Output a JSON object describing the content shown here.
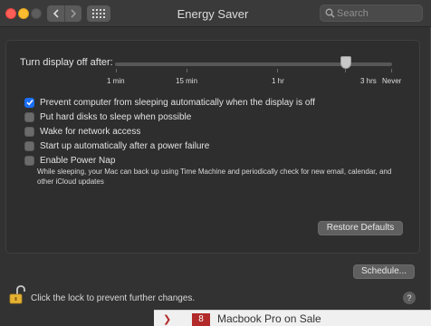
{
  "window": {
    "title": "Energy Saver",
    "search_placeholder": "Search"
  },
  "slider": {
    "label": "Turn display off after:",
    "value": "3 hrs",
    "ticks": [
      "1 min",
      "15 min",
      "1 hr",
      "3 hrs",
      "Never"
    ]
  },
  "options": [
    {
      "label": "Prevent computer from sleeping automatically when the display is off",
      "checked": true
    },
    {
      "label": "Put hard disks to sleep when possible",
      "checked": false
    },
    {
      "label": "Wake for network access",
      "checked": false
    },
    {
      "label": "Start up automatically after a power failure",
      "checked": false
    },
    {
      "label": "Enable Power Nap",
      "checked": false
    }
  ],
  "power_nap_description": "While sleeping, your Mac can back up using Time Machine and periodically check for new email, calendar, and other iCloud updates",
  "buttons": {
    "restore_defaults": "Restore Defaults",
    "schedule": "Schedule..."
  },
  "lock_text": "Click the lock to prevent further changes.",
  "help_label": "?",
  "background_window": {
    "badge": "8",
    "text": "Macbook Pro on Sale"
  },
  "colors": {
    "accent": "#1b6ff5",
    "window_bg": "#323232"
  }
}
